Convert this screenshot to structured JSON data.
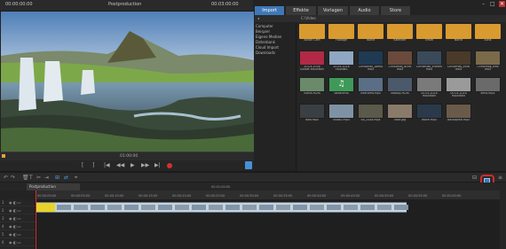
{
  "header": {
    "left_timecode": "00:00:00:00",
    "title": "Postproduction",
    "right_timecode": "00:03:00:00"
  },
  "window_controls": {
    "minimize": "–",
    "maximize": "□",
    "close": "✕"
  },
  "preview_bar": {
    "timecode": "01:00:00"
  },
  "transport": {
    "mark_in": "[",
    "mark_out": "]",
    "prev_marker": "|◀",
    "prev": "◀◀",
    "play": "▶",
    "next": "▶▶",
    "next_marker": "▶|"
  },
  "media_pool": {
    "tabs": [
      "Import",
      "Effekte",
      "Vorlagen",
      "Audio",
      "Store"
    ],
    "active_tab": "Import",
    "path": "C:\\Video",
    "sidebar": [
      "Computer",
      "Beispiel",
      "Eigene Medien",
      "Datenbank",
      "Cloud Import",
      "Downloads"
    ],
    "items": [
      {
        "label": "Action Cam",
        "kind": "folder",
        "color": "#d99a2f"
      },
      {
        "label": "Footage",
        "kind": "folder",
        "color": "#d99a2f"
      },
      {
        "label": "Island",
        "kind": "folder",
        "color": "#d99a2f"
      },
      {
        "label": "Kalender",
        "kind": "folder",
        "color": "#d99a2f"
      },
      {
        "label": "Travel",
        "kind": "folder",
        "color": "#d99a2f"
      },
      {
        "label": "Nacht",
        "kind": "folder",
        "color": "#d99a2f"
      },
      {
        "label": "Alina",
        "kind": "folder",
        "color": "#d99a2f"
      },
      {
        "label": "20.04.2016 sunset mountain balkan",
        "kind": "media",
        "color": "#b02a46"
      },
      {
        "label": "20.04.2016 chunder mountain balkan",
        "kind": "media",
        "color": "#8fa7c0"
      },
      {
        "label": "Christmas_Demo mp4",
        "kind": "media",
        "color": "#1f3a52"
      },
      {
        "label": "Christmas_drink mp4",
        "kind": "media",
        "color": "#6a4a3a"
      },
      {
        "label": "Christmas_interest mp4",
        "kind": "media",
        "color": "#3a4a5a"
      },
      {
        "label": "Christmas_intro mp4",
        "kind": "media",
        "color": "#4a3a2a"
      },
      {
        "label": "Christmas_tree mp4",
        "kind": "media",
        "color": "#7a6a4a"
      },
      {
        "label": "island.m2ts",
        "kind": "media",
        "color": "#6a8a6a"
      },
      {
        "label": "Bellaroma",
        "kind": "audio",
        "color": "#3f9a5a"
      },
      {
        "label": "interview.mp4",
        "kind": "media",
        "color": "#5a6f85"
      },
      {
        "label": "Nikolaji.m2ts",
        "kind": "media",
        "color": "#4a5a6a"
      },
      {
        "label": "00.04.2016 mountain panorama",
        "kind": "media",
        "color": "#7a7a7a"
      },
      {
        "label": "00.04.2016 mountain panorama",
        "kind": "media",
        "color": "#9a9a9a"
      },
      {
        "label": "kerio.mp4",
        "kind": "media",
        "color": "#6a6a6a"
      },
      {
        "label": "bow.mp4",
        "kind": "media",
        "color": "#3a3f44"
      },
      {
        "label": "snow2.mp4",
        "kind": "media",
        "color": "#7f92a4"
      },
      {
        "label": "SB_2448.mp4",
        "kind": "media",
        "color": "#5a5a4a"
      },
      {
        "label": "Toda.jpg",
        "kind": "media",
        "color": "#8a7a6a"
      },
      {
        "label": "Wave.mp4",
        "kind": "media",
        "color": "#2a3a4a"
      },
      {
        "label": "Ballkopfad.mp4",
        "kind": "media",
        "color": "#6a5a4a"
      }
    ]
  },
  "timeline": {
    "tab_label": "Postproduction",
    "ruler_start": "00:01:00:00",
    "ticks": [
      "00:00:00:00",
      "00:00:05:00",
      "00:00:10:00",
      "00:00:15:00",
      "00:00:20:00",
      "00:00:25:00",
      "00:00:30:00",
      "00:00:35:00",
      "00:00:40:00",
      "00:00:45:00",
      "00:00:50:00",
      "00:00:55:00",
      "00:01:00:00"
    ],
    "track_numbers": [
      "1",
      "2",
      "3",
      "4",
      "5",
      "6"
    ],
    "clip_name": "Clip"
  },
  "toolbar": {
    "undo": "↶",
    "redo": "↷",
    "delete": "🗑",
    "text": "T",
    "cut": "✂",
    "insert": "⇥",
    "group": "⊞",
    "link": "⇄",
    "snap": "⌖",
    "mode_label": "⊟",
    "storyboard_button": "▦",
    "menu": "≡"
  }
}
